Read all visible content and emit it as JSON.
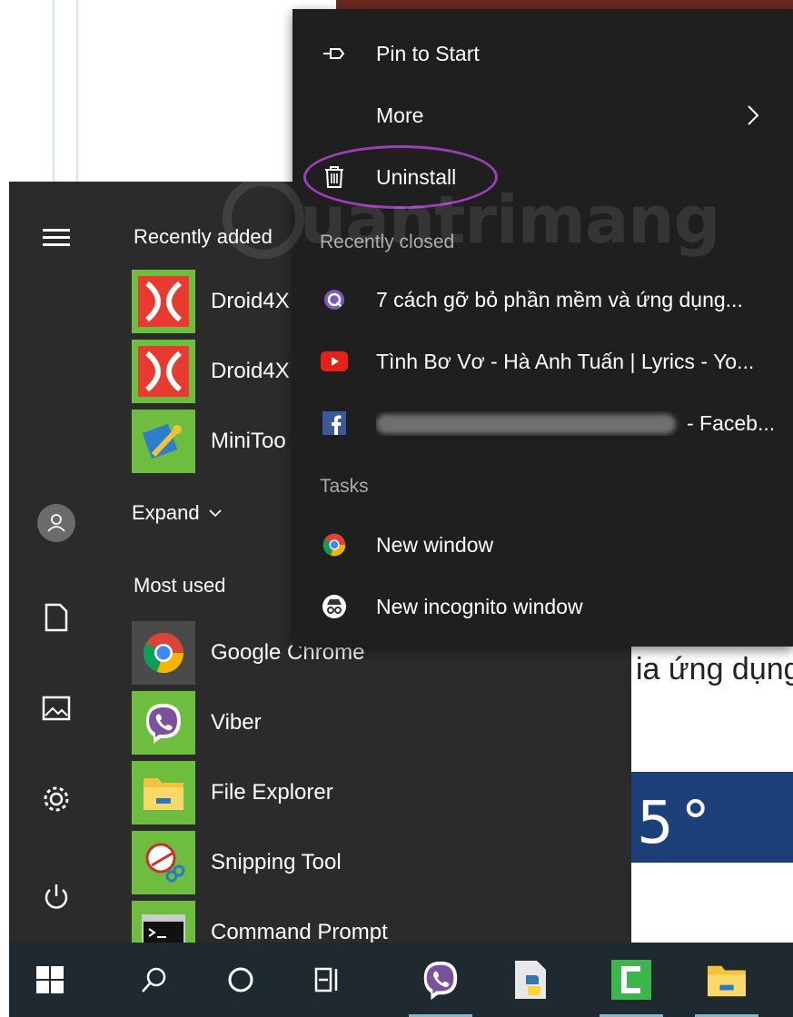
{
  "background_page": {
    "visible_text": "ia ứng dụng",
    "banner_text": "5°"
  },
  "start_menu": {
    "recently_added_heading": "Recently added",
    "recently_added": [
      {
        "label": "Droid4X",
        "icon": "droid4x-icon"
      },
      {
        "label": "Droid4X",
        "icon": "droid4x-icon"
      },
      {
        "label": "MiniToo",
        "icon": "minitool-icon"
      }
    ],
    "expand_label": "Expand",
    "most_used_heading": "Most used",
    "most_used": [
      {
        "label": "Google Chrome",
        "icon": "chrome-icon"
      },
      {
        "label": "Viber",
        "icon": "viber-icon"
      },
      {
        "label": "File Explorer",
        "icon": "folder-icon"
      },
      {
        "label": "Snipping Tool",
        "icon": "snipping-tool-icon"
      },
      {
        "label": "Command Prompt",
        "icon": "command-prompt-icon"
      }
    ]
  },
  "jump_list": {
    "pin_to_start": "Pin to Start",
    "more": "More",
    "uninstall": "Uninstall",
    "recently_closed_heading": "Recently closed",
    "recently_closed": [
      {
        "label": "7 cách gỡ bỏ phần mềm và ứng dụng...",
        "icon": "site-quantrimang-icon"
      },
      {
        "label": "Tình Bơ Vơ - Hà Anh Tuấn | Lyrics - Yo...",
        "icon": "youtube-icon"
      },
      {
        "label": "- Faceb...",
        "icon": "facebook-icon"
      }
    ],
    "tasks_heading": "Tasks",
    "tasks": [
      {
        "label": "New window",
        "icon": "chrome-icon"
      },
      {
        "label": "New incognito window",
        "icon": "incognito-icon"
      }
    ]
  },
  "watermark": "uantrimang",
  "colors": {
    "menu_bg": "#2b2b2b",
    "jump_bg": "#1f1f1f",
    "tile_green": "#6dbe3f",
    "highlight_ring": "#9a3fb5",
    "taskbar_bg": "#1e2a30"
  }
}
